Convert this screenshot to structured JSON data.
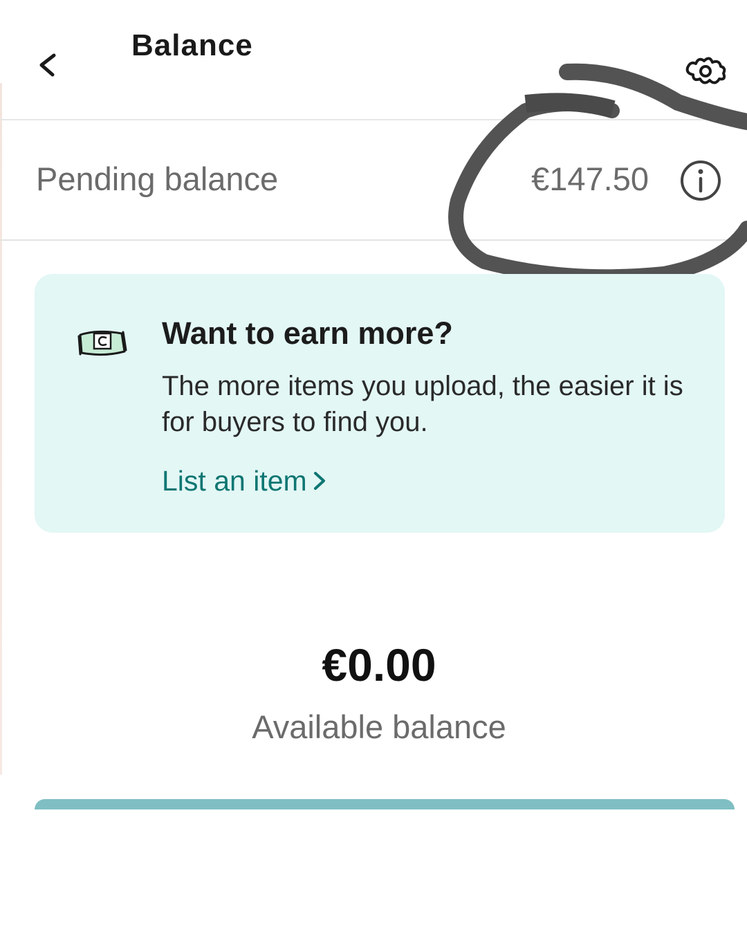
{
  "header": {
    "title": "Balance",
    "back_icon": "chevron-left-icon",
    "settings_icon": "gear-icon"
  },
  "pending": {
    "label": "Pending balance",
    "amount": "€147.50",
    "info_icon": "info-icon"
  },
  "promo": {
    "icon": "money-icon",
    "title": "Want to earn more?",
    "body": "The more items you upload, the easier it is for buyers to find you.",
    "link_label": "List an item",
    "link_icon": "chevron-right-icon"
  },
  "available": {
    "amount": "€0.00",
    "label": "Available balance"
  },
  "colors": {
    "accent": "#0e7672",
    "card_background": "#e3f7f5",
    "bottom_bar": "#7fbfc3",
    "annotation_ink": "#4a4a4a"
  }
}
